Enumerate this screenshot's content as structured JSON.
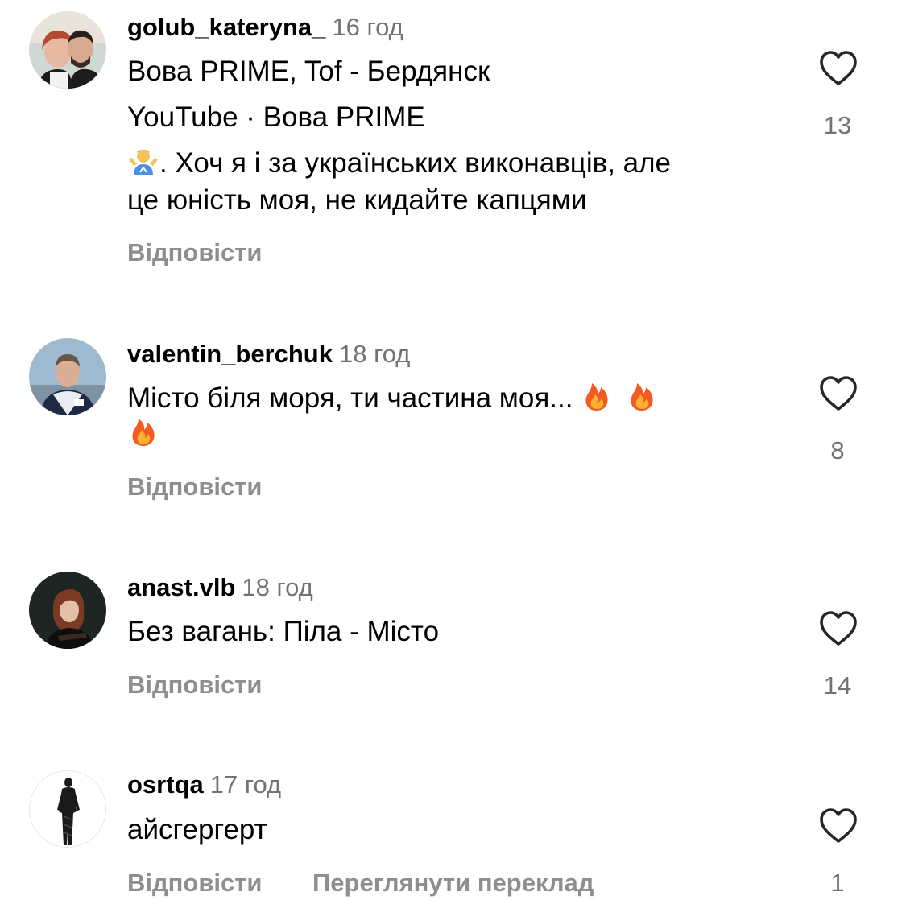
{
  "comments": [
    {
      "username": "golub_kateryna_",
      "time": "16 год",
      "lines": [
        "Вова PRIME, Tof - Бердянск",
        "YouTube · Вова PRIME"
      ],
      "emoji_line_text": ". Хоч я і за українських виконавців, але",
      "emoji_line_icon": "person-shrugging-emoji",
      "last_line": "це юність моя, не кидайте капцями",
      "likes": "13",
      "reply_label": "Відповісти"
    },
    {
      "username": "valentin_berchuk",
      "time": "18 год",
      "text": "Місто біля моря, ти частина моя...",
      "emoji_icon": "fire-emoji",
      "likes": "8",
      "reply_label": "Відповісти"
    },
    {
      "username": "anast.vlb",
      "time": "18 год",
      "text": "Без вагань: Піла - Місто",
      "likes": "14",
      "reply_label": "Відповісти"
    },
    {
      "username": "osrtqa",
      "time": "17 год",
      "text": "айсгергерт",
      "likes": "1",
      "reply_label": "Відповісти",
      "translate_label": "Переглянути переклад"
    }
  ],
  "icons": {
    "like": "heart-outline-icon"
  },
  "colors": {
    "secondary_text": "#737373",
    "reply_text": "#8e8e8e",
    "divider": "#dbdbdb"
  }
}
